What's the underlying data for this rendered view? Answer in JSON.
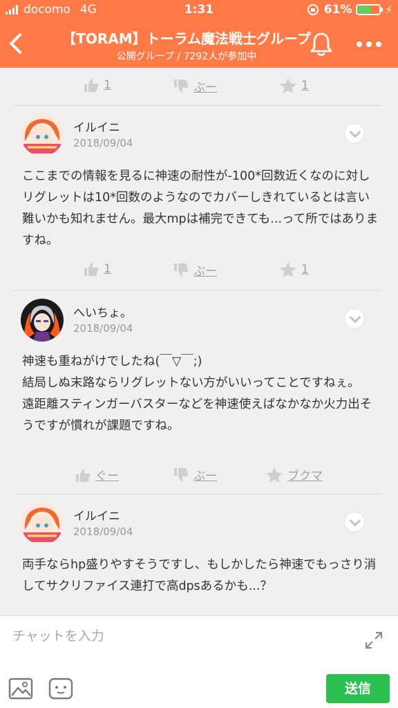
{
  "status_bar": {
    "carrier": "docomo",
    "network": "4G",
    "time": "1:31",
    "battery": "61%",
    "battery_level": 0.61
  },
  "header": {
    "title": "【TORAM】トーラム魔法戦士グループ",
    "subtitle": "公開グループ / 7292人が参加中"
  },
  "comments": [
    {
      "reactions": {
        "like": "1",
        "dislike": "ぶー",
        "star": "1"
      }
    },
    {
      "name": "イルイニ",
      "date": "2018/09/04",
      "body": "ここまでの情報を見るに神速の耐性が-100*回数近くなのに対しリグレットは10*回数のようなのでカバーしきれているとは言い難いかも知れません。最大mpは補完できても...って所ではありますね。",
      "reactions": {
        "like": "1",
        "dislike": "ぶー",
        "star": "1"
      }
    },
    {
      "name": "へいちょ。",
      "date": "2018/09/04",
      "body": "神速も重ねがけでしたね(￣▽￣;)\n結局しぬ末路ならリグレットない方がいいってことですねぇ。\n遠距離スティンガーバスターなどを神速使えばなかなか火力出そうですが慣れが課題ですね。",
      "reactions": {
        "like": "ぐー",
        "dislike": "ぶー",
        "star": "ブクマ"
      }
    },
    {
      "name": "イルイニ",
      "date": "2018/09/04",
      "body": "両手ならhp盛りやすそうですし、もしかしたら神速でもっさり消してサクリファイス連打で高dpsあるかも...？"
    }
  ],
  "input": {
    "placeholder": "チャットを入力",
    "send_label": "送信"
  },
  "colors": {
    "header": "#ff7a46",
    "send": "#2bc04f",
    "battery": "#4cd964"
  }
}
